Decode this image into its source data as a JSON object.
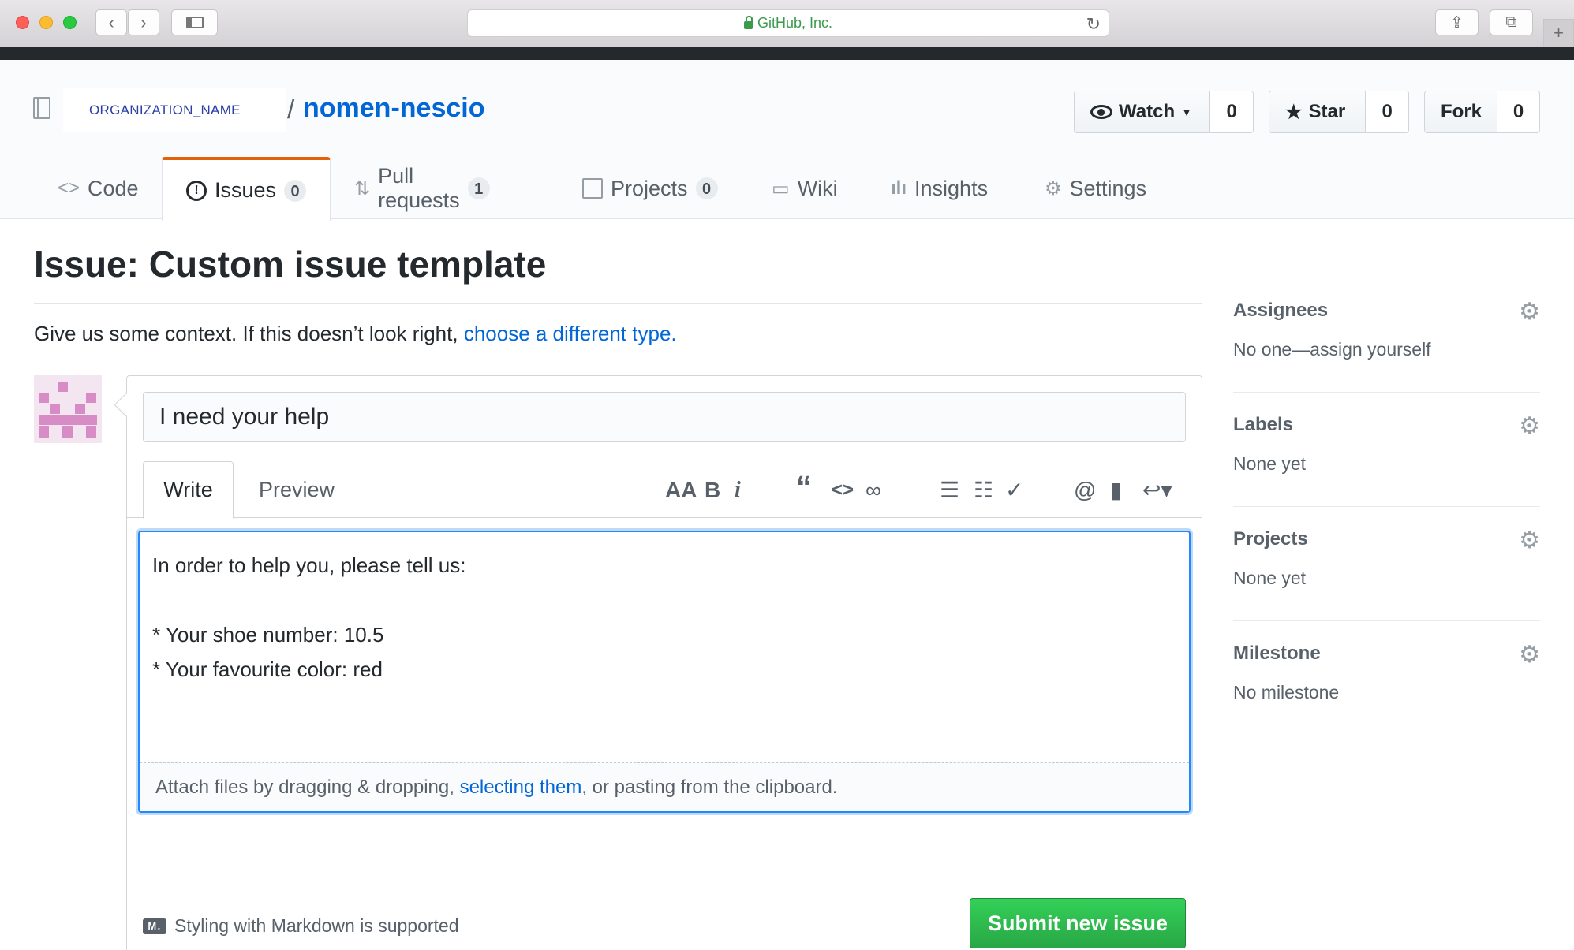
{
  "browser": {
    "url_title": "GitHub, Inc."
  },
  "repo": {
    "org": "ORGANIZATION_NAME",
    "separator": "/",
    "name": "nomen-nescio",
    "watch_label": "Watch",
    "watch_count": "0",
    "star_label": "Star",
    "star_count": "0",
    "fork_label": "Fork",
    "fork_count": "0"
  },
  "tabs": [
    {
      "label": "Code",
      "count": ""
    },
    {
      "label": "Issues",
      "count": "0"
    },
    {
      "label": "Pull requests",
      "count": "1"
    },
    {
      "label": "Projects",
      "count": "0"
    },
    {
      "label": "Wiki",
      "count": ""
    },
    {
      "label": "Insights",
      "count": ""
    },
    {
      "label": "Settings",
      "count": ""
    }
  ],
  "issue": {
    "page_title": "Issue: Custom issue template",
    "context_text": "Give us some context. If this doesn’t look right, ",
    "context_link": "choose a different type.",
    "title_value": "I need your help",
    "write_tab": "Write",
    "preview_tab": "Preview",
    "body_text": "In order to help you, please tell us:\n\n* Your shoe number: 10.5\n* Your favourite color: red",
    "attach_prefix": "Attach files by dragging & dropping, ",
    "attach_link": "selecting them",
    "attach_suffix": ", or pasting from the clipboard.",
    "markdown_note": "Styling with Markdown is supported",
    "markdown_badge": "M↓",
    "submit_label": "Submit new issue"
  },
  "sidebar": {
    "assignees": {
      "title": "Assignees",
      "value": "No one—assign yourself"
    },
    "labels": {
      "title": "Labels",
      "value": "None yet"
    },
    "projects": {
      "title": "Projects",
      "value": "None yet"
    },
    "milestone": {
      "title": "Milestone",
      "value": "No milestone"
    }
  },
  "colors": {
    "link": "#0366d6",
    "active_tab_accent": "#e36209",
    "submit_green": "#28a745"
  }
}
